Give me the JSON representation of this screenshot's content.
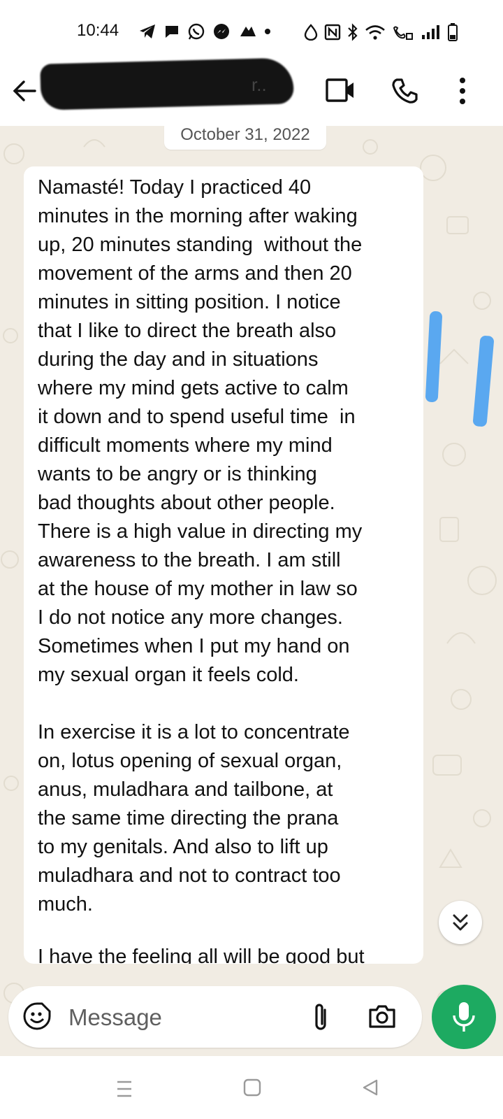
{
  "status_bar": {
    "time": "10:44",
    "icons": [
      "telegram-icon",
      "chat-bubble-icon",
      "whatsapp-icon",
      "messenger-icon",
      "more-apps-icon",
      "notification-dot-icon",
      "alarm-icon",
      "nfc-icon",
      "bluetooth-icon",
      "wifi-icon",
      "wifi-calling-icon",
      "signal-icon",
      "battery-icon"
    ]
  },
  "header": {
    "contact_name_visible": "r..",
    "icons": [
      "back-arrow-icon",
      "video-call-icon",
      "voice-call-icon",
      "more-options-icon"
    ]
  },
  "chat": {
    "date_chip": "October 31, 2022",
    "message": {
      "text": "Namasté! Today I practiced 40\nminutes in the morning after waking\nup, 20 minutes standing  without the\nmovement of the arms and then 20\nminutes in sitting position. I notice\nthat I like to direct the breath also\nduring the day and in situations\nwhere my mind gets active to calm\nit down and to spend useful time  in\ndifficult moments where my mind\nwants to be angry or is thinking\nbad thoughts about other people.\nThere is a high value in directing my\nawareness to the breath. I am still\nat the house of my mother in law so\nI do not notice any more changes.\nSometimes when I put my hand on\nmy sexual organ it feels cold.\n\nIn exercise it is a lot to concentrate\non, lotus opening of sexual organ,\nanus, muladhara and tailbone, at\nthe same time directing the prana\nto my genitals. And also to lift up\nmuladhara and not to contract too\nmuch.",
      "partial_line": "I have the feeling all will be good but"
    }
  },
  "composer": {
    "placeholder": "Message"
  },
  "colors": {
    "chat_background": "#f1ece3",
    "mic_button": "#1daa61",
    "highlight_marks": "#5aa8f0"
  }
}
